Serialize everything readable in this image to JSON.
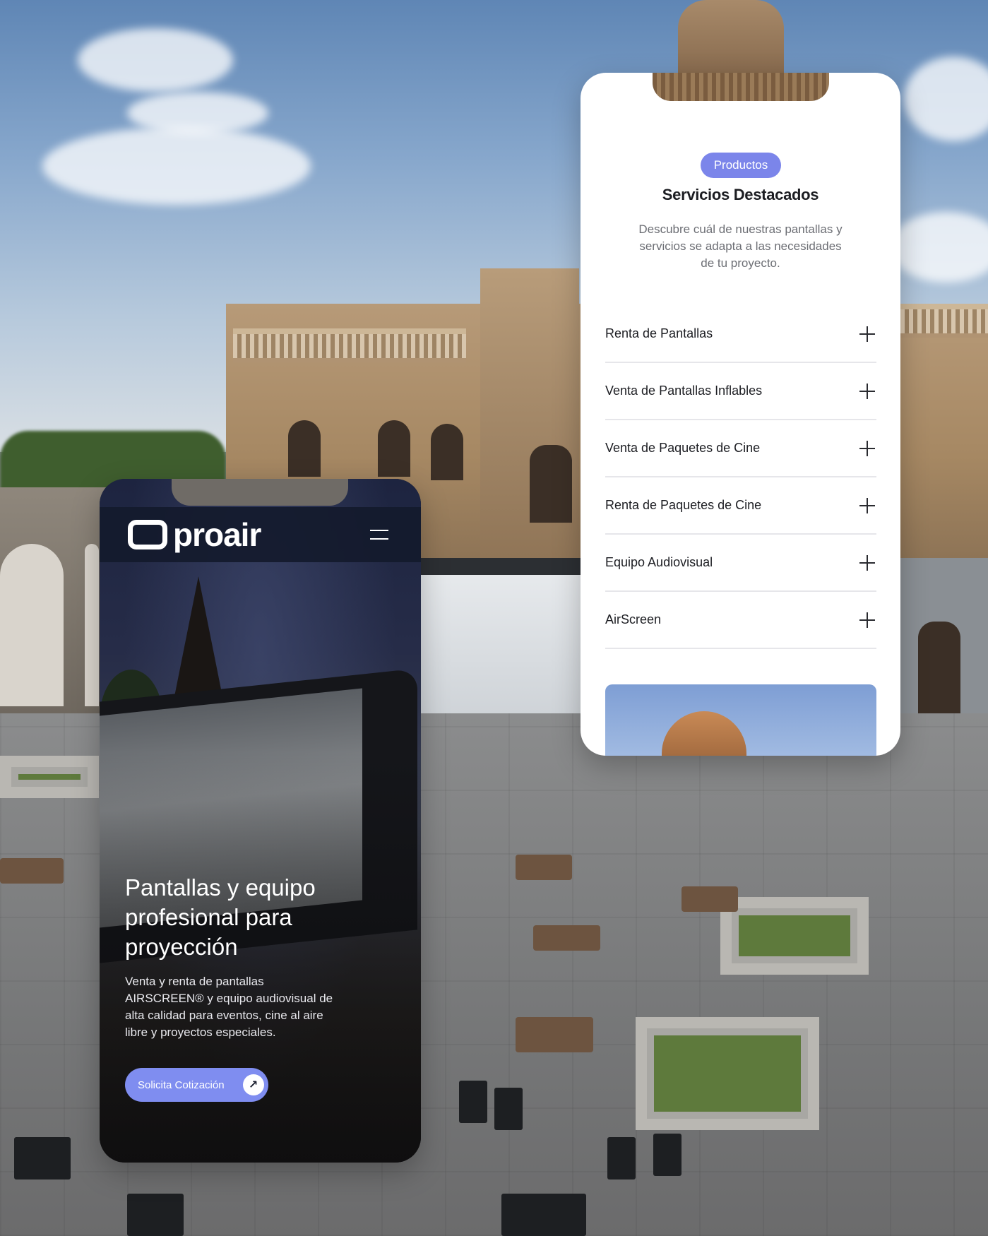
{
  "hero_phone": {
    "logo_text": "proair",
    "menu_icon": "hamburger-menu-icon",
    "title": "Pantallas y equipo profesional para proyección",
    "description": "Venta y renta de pantallas AIRSCREEN® y equipo audiovisual de alta calidad para eventos, cine al aire libre y proyectos especiales.",
    "cta_label": "Solicita Cotización",
    "cta_icon": "arrow-up-right-icon"
  },
  "services_phone": {
    "tag": "Productos",
    "title": "Servicios Destacados",
    "description": "Descubre cuál de nuestras pantallas y servicios se adapta a las necesidades de tu proyecto.",
    "items": [
      {
        "label": "Renta de Pantallas"
      },
      {
        "label": "Venta de Pantallas Inflables"
      },
      {
        "label": "Venta de Paquetes de Cine"
      },
      {
        "label": "Renta de Paquetes de Cine"
      },
      {
        "label": "Equipo Audiovisual"
      },
      {
        "label": "AirScreen"
      }
    ],
    "item_icon": "plus-icon"
  },
  "colors": {
    "accent": "#7b85ea",
    "hero_bg": "#1b2030",
    "card_bg": "#ffffff",
    "text_dark": "#1c1d22",
    "text_muted": "#6c6e74"
  }
}
